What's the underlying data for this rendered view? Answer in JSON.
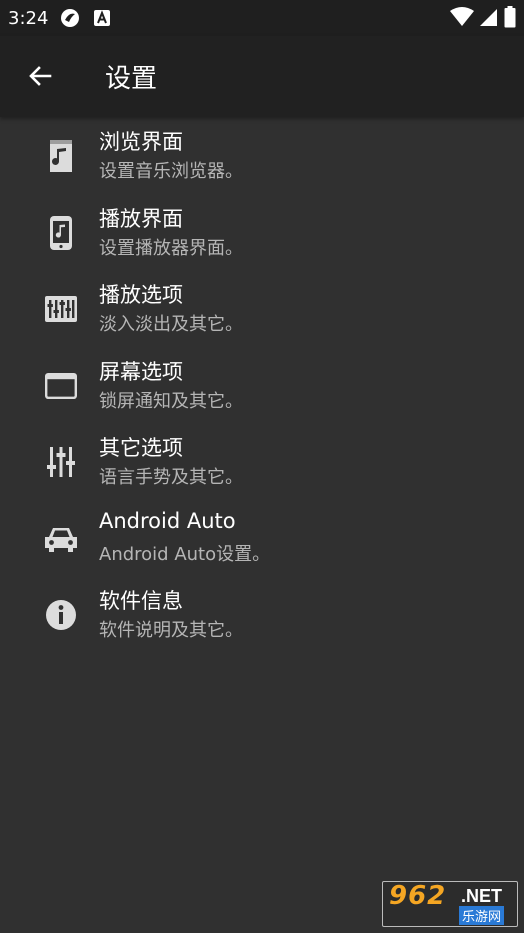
{
  "status_bar": {
    "time": "3:24",
    "icons": [
      "app-notification-icon",
      "font-notification-icon",
      "wifi-icon",
      "signal-icon",
      "battery-icon"
    ]
  },
  "app_bar": {
    "title": "设置"
  },
  "settings": {
    "items": [
      {
        "icon": "music-file-icon",
        "title": "浏览界面",
        "subtitle": "设置音乐浏览器。"
      },
      {
        "icon": "phone-music-icon",
        "title": "播放界面",
        "subtitle": "设置播放器界面。"
      },
      {
        "icon": "equalizer-icon",
        "title": "播放选项",
        "subtitle": "淡入淡出及其它。"
      },
      {
        "icon": "window-icon",
        "title": "屏幕选项",
        "subtitle": "锁屏通知及其它。"
      },
      {
        "icon": "tune-icon",
        "title": "其它选项",
        "subtitle": "语言手势及其它。"
      },
      {
        "icon": "car-icon",
        "title": "Android Auto",
        "subtitle": "Android Auto设置。"
      },
      {
        "icon": "info-icon",
        "title": "软件信息",
        "subtitle": "软件说明及其它。"
      }
    ]
  },
  "watermark": {
    "logo": "962",
    "suffix": ".NET",
    "caption": "乐游网"
  },
  "colors": {
    "background": "#303030",
    "app_bar": "#212121",
    "status_bar": "#1f1f1f",
    "secondary_text": "#b5b5b5"
  }
}
